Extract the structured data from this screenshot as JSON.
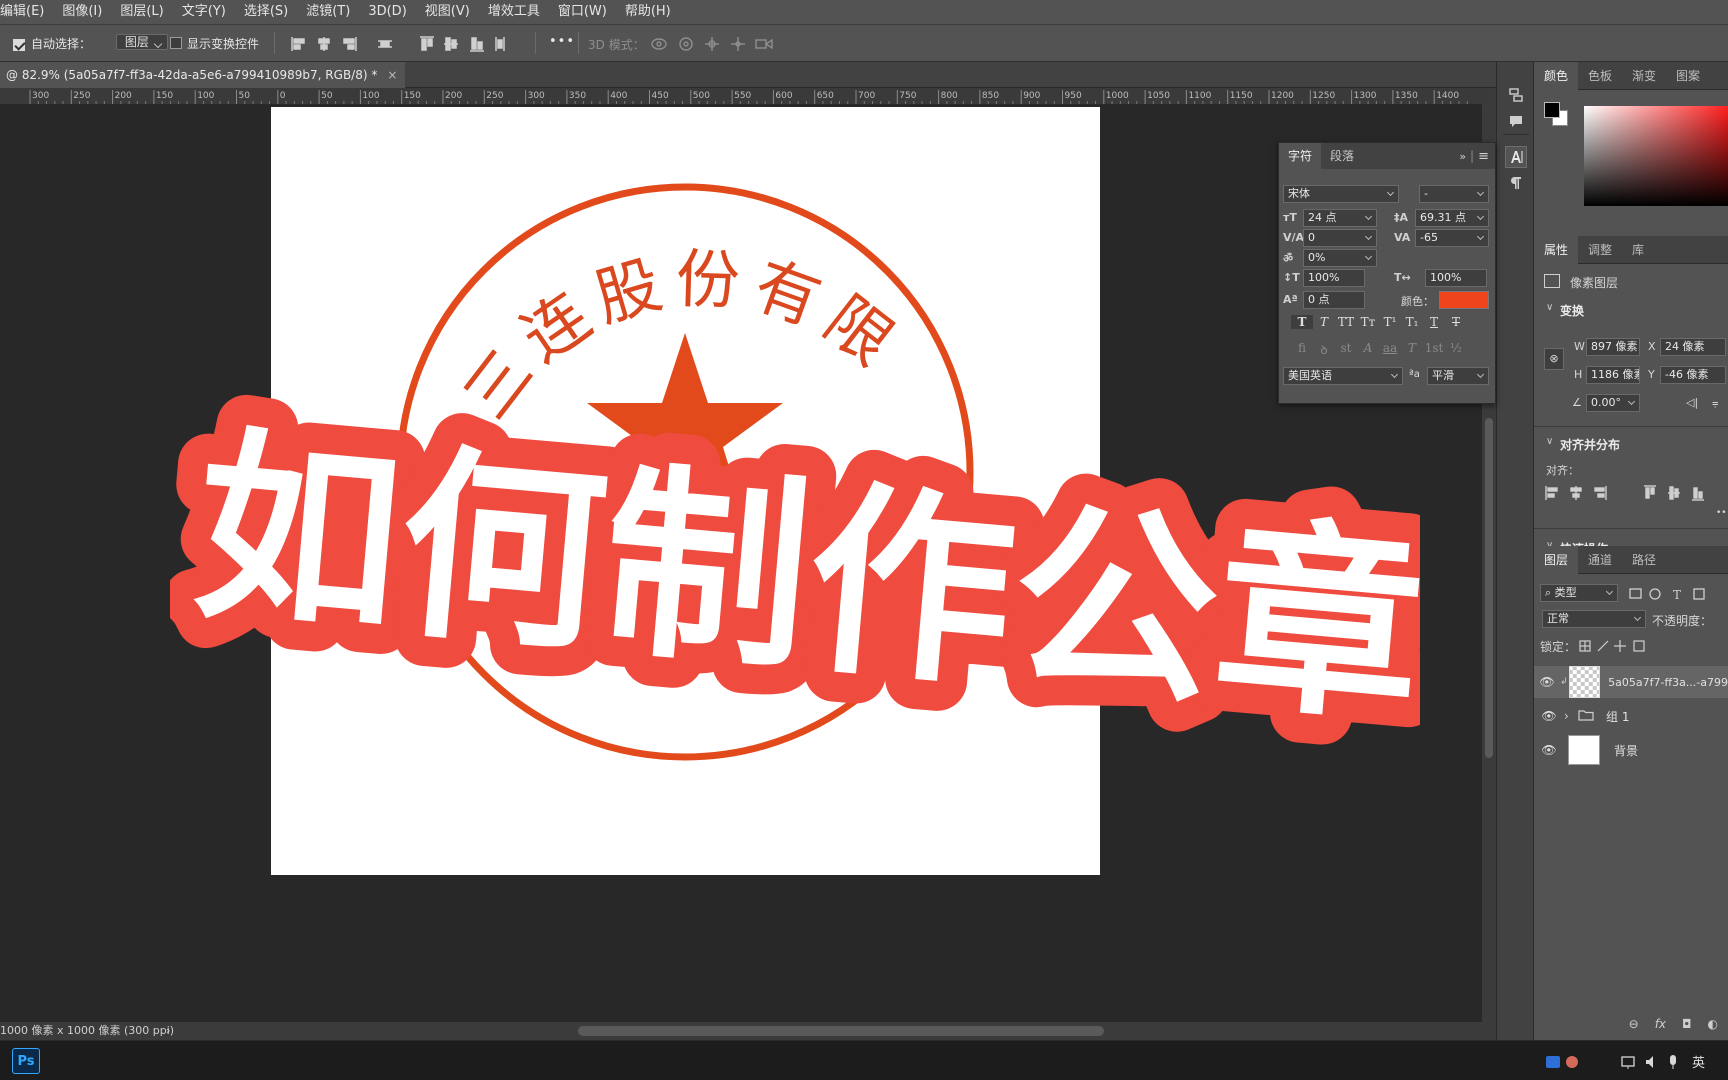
{
  "menu": [
    "编辑(E)",
    "图像(I)",
    "图层(L)",
    "文字(Y)",
    "选择(S)",
    "滤镜(T)",
    "3D(D)",
    "视图(V)",
    "增效工具",
    "窗口(W)",
    "帮助(H)"
  ],
  "options": {
    "auto_select_label": "自动选择：",
    "auto_select_value": "图层",
    "show_transform_label": "显示变换控件",
    "more_label": "•••",
    "mode3d_label": "3D 模式："
  },
  "doc_tab": {
    "title": "@ 82.9% (5a05a7f7-ff3a-42da-a5e6-a799410989b7, RGB/8) *",
    "close": "×"
  },
  "ruler": {
    "ticks": [
      "300",
      "250",
      "200",
      "150",
      "100",
      "50",
      "0",
      "50",
      "100",
      "150",
      "200",
      "250",
      "300",
      "350",
      "400",
      "450",
      "500",
      "550",
      "600",
      "650",
      "700",
      "750",
      "800",
      "850",
      "900",
      "950",
      "1000",
      "1050",
      "1100",
      "1150",
      "1200",
      "1250",
      "1300",
      "1350",
      "1400"
    ]
  },
  "artwork": {
    "seal_text": "键三连股份有限",
    "overlay_title": "如何制作公章",
    "seal_color": "#e24a1c",
    "title_outline_color": "#ef4b3f"
  },
  "status": {
    "doc_size": "1000 像素 x 1000 像素 (300 ppi)",
    "arrow": "›"
  },
  "taskbar": {
    "ps": "Ps",
    "ime": "英"
  },
  "char_panel": {
    "tabs": [
      "字符",
      "段落"
    ],
    "font_family": "宋体",
    "font_style": "-",
    "font_size": "24 点",
    "leading": "69.31 点",
    "kerning": "0",
    "tracking": "-65",
    "tsume": "0%",
    "vscale": "100%",
    "hscale": "100%",
    "baseline": "0 点",
    "color_label": "颜色：",
    "color": "#f0451b",
    "style_buttons": [
      "T",
      "T",
      "TT",
      "Tт",
      "T¹",
      "T₁",
      "T",
      "T"
    ],
    "ot_buttons": [
      "fi",
      "ꝺ",
      "st",
      "A",
      "aa",
      "T",
      "1st",
      "½"
    ],
    "language": "美国英语",
    "aa_label": "ªa",
    "antialias": "平滑"
  },
  "color_panel": {
    "tabs": [
      "颜色",
      "色板",
      "渐变",
      "图案"
    ],
    "fg": "#000000",
    "bg": "#ffffff"
  },
  "properties": {
    "tabs": [
      "属性",
      "调整",
      "库"
    ],
    "layer_kind": "像素图层",
    "transform_title": "变换",
    "w_label": "W",
    "w": "897 像素",
    "x_label": "X",
    "x": "24 像素",
    "h_label": "H",
    "h": "1186 像素",
    "y_label": "Y",
    "y": "-46 像素",
    "angle": "0.00°",
    "align_title": "对齐并分布",
    "align_label": "对齐：",
    "quick_title": "快速操作",
    "more": "•••"
  },
  "layers": {
    "tabs": [
      "图层",
      "通道",
      "路径"
    ],
    "filter": "类型",
    "blend": "正常",
    "opacity_label": "不透明度：",
    "lock_label": "锁定：",
    "items": [
      {
        "name": "5a05a7f7-ff3a...-a799",
        "type": "pixel"
      },
      {
        "name": "组 1",
        "type": "group"
      },
      {
        "name": "背景",
        "type": "background"
      }
    ],
    "footer": [
      "⊖",
      "fx",
      "◘",
      "◐"
    ]
  }
}
